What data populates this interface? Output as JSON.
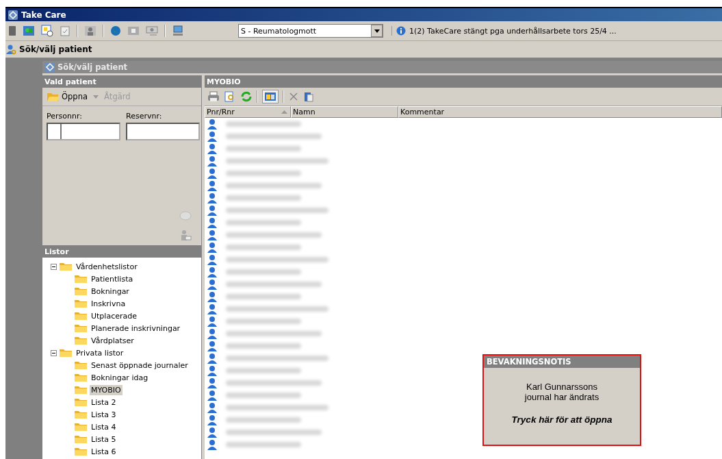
{
  "window": {
    "title": "Take Care"
  },
  "toolbar": {
    "unit_select": {
      "value": "S - Reumatologmott"
    },
    "message": "1(2) TakeCare stängt pga underhållsarbete tors 25/4 ..."
  },
  "breadcrumb": "Sök/välj patient",
  "inner_window": {
    "title": "Sök/välj patient"
  },
  "selected_patient": {
    "header": "Vald patient",
    "actions": [
      {
        "label": "Öppna",
        "disabled": false
      },
      {
        "label": "Åtgärd",
        "disabled": true
      }
    ],
    "fields": [
      {
        "label": "Personnr:"
      },
      {
        "label": "Reservnr:"
      }
    ]
  },
  "lists": {
    "header": "Listor",
    "tree": [
      {
        "label": "Vårdenhetslistor",
        "expanded": true,
        "selected": false,
        "children": [
          {
            "label": "Patientlista",
            "selected": false
          },
          {
            "label": "Bokningar",
            "selected": false
          },
          {
            "label": "Inskrivna",
            "selected": false
          },
          {
            "label": "Utplacerade",
            "selected": false
          },
          {
            "label": "Planerade inskrivningar",
            "selected": false
          },
          {
            "label": "Vårdplatser",
            "selected": false
          }
        ]
      },
      {
        "label": "Privata listor",
        "expanded": true,
        "selected": false,
        "children": [
          {
            "label": "Senast öppnade journaler",
            "selected": false
          },
          {
            "label": "Bokningar idag",
            "selected": false
          },
          {
            "label": "MYOBIO",
            "selected": true
          },
          {
            "label": "Lista 2",
            "selected": false
          },
          {
            "label": "Lista 3",
            "selected": false
          },
          {
            "label": "Lista 4",
            "selected": false
          },
          {
            "label": "Lista 5",
            "selected": false
          },
          {
            "label": "Lista 6",
            "selected": false
          }
        ]
      }
    ]
  },
  "patient_list": {
    "header": "MYOBIO",
    "columns": [
      "Pnr/Rnr",
      "Namn",
      "Kommentar"
    ],
    "rows": [
      {
        "kind": "blurred"
      },
      {
        "kind": "blurred"
      },
      {
        "kind": "blurred"
      },
      {
        "kind": "blurred"
      },
      {
        "kind": "blurred"
      },
      {
        "kind": "blurred"
      },
      {
        "kind": "blurred"
      },
      {
        "kind": "blurred"
      },
      {
        "kind": "blurred"
      },
      {
        "kind": "blurred"
      },
      {
        "kind": "blurred"
      },
      {
        "kind": "blurred"
      },
      {
        "kind": "blurred"
      },
      {
        "kind": "blurred"
      },
      {
        "kind": "blurred"
      },
      {
        "kind": "blurred"
      },
      {
        "kind": "blurred"
      },
      {
        "kind": "blurred"
      },
      {
        "kind": "blurred"
      },
      {
        "kind": "blurred"
      },
      {
        "kind": "blurred"
      },
      {
        "kind": "blurred"
      },
      {
        "kind": "blurred"
      },
      {
        "kind": "blurred"
      },
      {
        "kind": "blurred"
      },
      {
        "kind": "blurred"
      },
      {
        "kind": "blurred"
      }
    ]
  },
  "notification": {
    "title": "BEVAKNINGSNOTIS",
    "message_lines": [
      "Karl Gunnarssons",
      "journal har ändrats"
    ],
    "action": "Tryck här för att öppna"
  }
}
